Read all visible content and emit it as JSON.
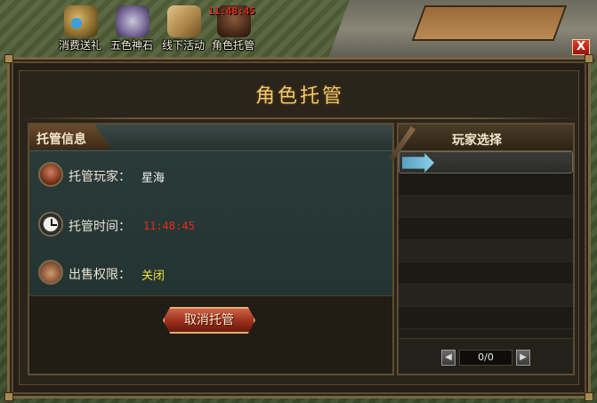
{
  "activities": [
    {
      "label": "消费送礼",
      "icon": "gift-icon"
    },
    {
      "label": "五色神石",
      "icon": "stone-icon"
    },
    {
      "label": "线下活动",
      "icon": "map-icon"
    },
    {
      "label": "角色托管",
      "icon": "role-icon"
    }
  ],
  "top_timer": "11:48:45",
  "close_label": "X",
  "dialog": {
    "title": "角色托管",
    "info_section": {
      "title": "托管信息",
      "player_label": "托管玩家：",
      "player_value": "星海",
      "time_label": "托管时间：",
      "time_value": "11:48:45",
      "perm_label": "出售权限：",
      "perm_value": "关闭"
    },
    "cancel_button": "取消托管",
    "player_select": {
      "title": "玩家选择",
      "pager_text": "0/0",
      "prev_symbol": "◀",
      "next_symbol": "▶"
    }
  },
  "colors": {
    "title": "#f0c870",
    "time_value": "#e82a1a",
    "perm_value": "#f0e040"
  }
}
